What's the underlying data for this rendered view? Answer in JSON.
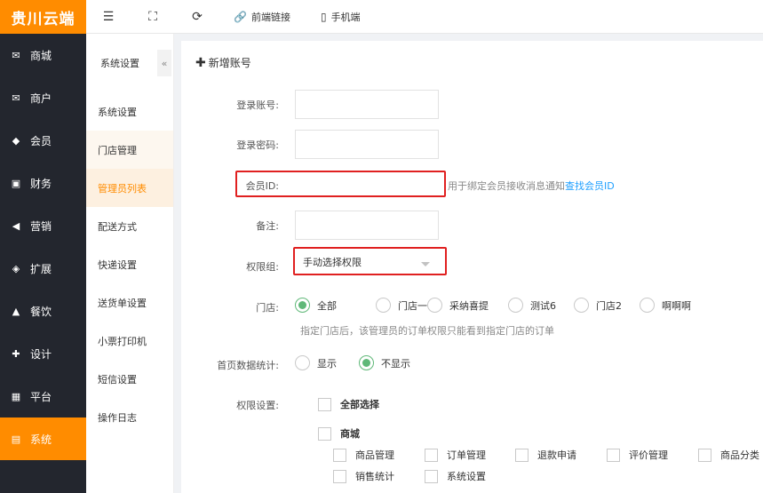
{
  "logo": "贵川云端",
  "nav": [
    {
      "label": "商城",
      "icon": "store-icon",
      "glyph": "✉"
    },
    {
      "label": "商户",
      "icon": "merchant-icon",
      "glyph": "✉"
    },
    {
      "label": "会员",
      "icon": "member-icon",
      "glyph": "◆"
    },
    {
      "label": "财务",
      "icon": "finance-icon",
      "glyph": "▣"
    },
    {
      "label": "营销",
      "icon": "marketing-icon",
      "glyph": "◀"
    },
    {
      "label": "扩展",
      "icon": "extension-icon",
      "glyph": "◈"
    },
    {
      "label": "餐饮",
      "icon": "dining-icon",
      "glyph": "▲"
    },
    {
      "label": "设计",
      "icon": "design-icon",
      "glyph": "✚"
    },
    {
      "label": "平台",
      "icon": "platform-icon",
      "glyph": "▦"
    },
    {
      "label": "系统",
      "icon": "system-icon",
      "glyph": "▤"
    }
  ],
  "topbar": {
    "frontend_link": "前端链接",
    "mobile": "手机端"
  },
  "submenu": {
    "title": "系统设置",
    "items": [
      "系统设置",
      "门店管理",
      "管理员列表",
      "配送方式",
      "快递设置",
      "送货单设置",
      "小票打印机",
      "短信设置",
      "操作日志"
    ]
  },
  "form": {
    "add_account": "新增账号",
    "login_account_label": "登录账号:",
    "login_password_label": "登录密码:",
    "member_id_label": "会员ID:",
    "member_id_hint": "用于绑定会员接收消息通知",
    "member_id_link": "查找会员ID",
    "remark_label": "备注:",
    "permission_group_label": "权限组:",
    "permission_group_value": "手动选择权限",
    "store_label": "门店:",
    "stores": [
      "全部",
      "门店一",
      "采纳喜提",
      "测试6",
      "门店2",
      "啊啊啊"
    ],
    "store_selected": "全部",
    "store_hint": "指定门店后，该管理员的订单权限只能看到指定门店的订单",
    "home_stats_label": "首页数据统计:",
    "home_stats_options": [
      "显示",
      "不显示"
    ],
    "home_stats_selected": "不显示",
    "permission_settings_label": "权限设置:",
    "select_all": "全部选择",
    "mall": "商城",
    "perm_row1": [
      "商品管理",
      "订单管理",
      "退款申请",
      "评价管理",
      "商品分类"
    ],
    "perm_row2": [
      "销售统计",
      "系统设置"
    ]
  }
}
